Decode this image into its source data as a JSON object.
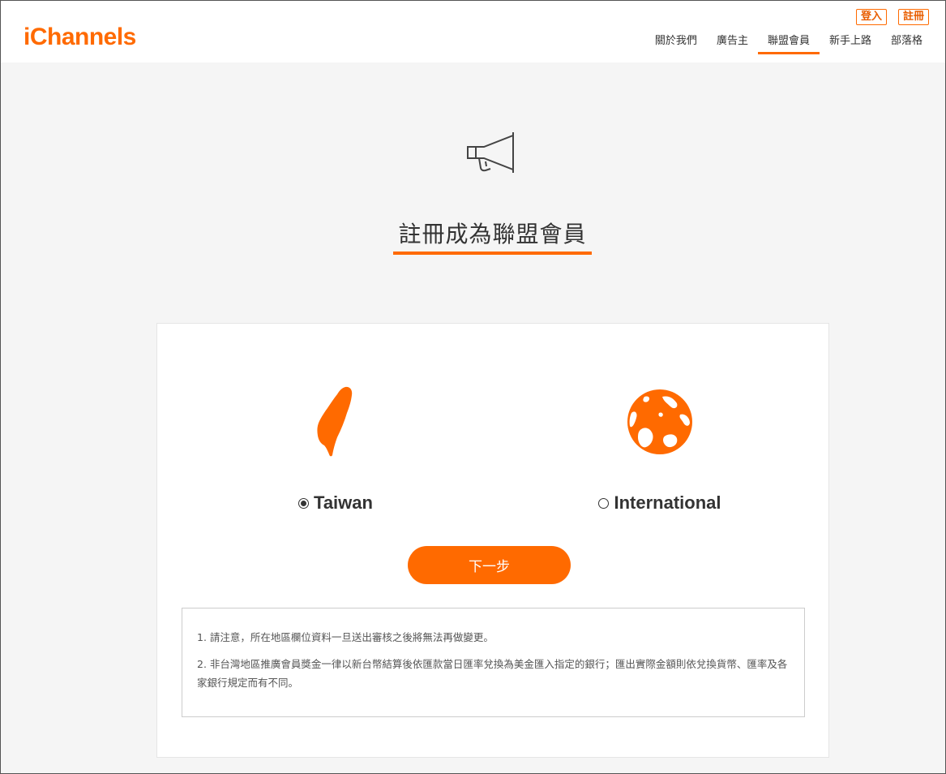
{
  "header": {
    "logo": "iChannels",
    "auth": {
      "login": "登入",
      "register": "註冊"
    },
    "nav": [
      {
        "label": "關於我們",
        "active": false
      },
      {
        "label": "廣告主",
        "active": false
      },
      {
        "label": "聯盟會員",
        "active": true
      },
      {
        "label": "新手上路",
        "active": false
      },
      {
        "label": "部落格",
        "active": false
      }
    ]
  },
  "main": {
    "hero_icon": "megaphone-icon",
    "title": "註冊成為聯盟會員",
    "options": {
      "taiwan": {
        "label": "Taiwan",
        "icon": "taiwan-map-icon",
        "selected": true
      },
      "international": {
        "label": "International",
        "icon": "globe-icon",
        "selected": false
      }
    },
    "next_button": "下一步",
    "notes": [
      "1. 請注意，所在地區欄位資料一旦送出審核之後將無法再做變更。",
      "2. 非台灣地區推廣會員獎金一律以新台幣結算後依匯款當日匯率兌換為美金匯入指定的銀行；匯出實際金額則依兌換貨幣、匯率及各家銀行規定而有不同。"
    ]
  },
  "colors": {
    "accent": "#ff6a00",
    "background": "#f5f5f5",
    "text": "#333333"
  }
}
